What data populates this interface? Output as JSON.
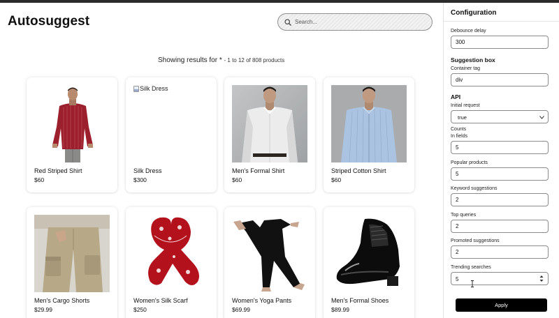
{
  "app": {
    "title": "Autosuggest"
  },
  "search": {
    "placeholder": "Search..."
  },
  "results": {
    "prefix": "Showing results for",
    "query": "*",
    "summary": "- 1 to 12 of 808 products"
  },
  "products": [
    {
      "name": "Red Striped Shirt",
      "price": "$60",
      "image": "red-shirt"
    },
    {
      "name": "Silk Dress",
      "price": "$300",
      "image": "broken",
      "alt": "Silk Dress"
    },
    {
      "name": "Men's Formal Shirt",
      "price": "$60",
      "image": "white-shirt"
    },
    {
      "name": "Striped Cotton Shirt",
      "price": "$60",
      "image": "blue-shirt"
    },
    {
      "name": "Men's Cargo Shorts",
      "price": "$29.99",
      "image": "cargo-shorts"
    },
    {
      "name": "Women's Silk Scarf",
      "price": "$250",
      "image": "silk-scarf"
    },
    {
      "name": "Women's Yoga Pants",
      "price": "$69.99",
      "image": "yoga-pants"
    },
    {
      "name": "Men's Formal Shoes",
      "price": "$89.99",
      "image": "formal-shoes"
    }
  ],
  "config": {
    "title": "Configuration",
    "debounce_label": "Debounce delay",
    "debounce_value": "300",
    "suggestion_box_title": "Suggestion box",
    "container_tag_label": "Container tag",
    "container_tag_value": "div",
    "api_title": "API",
    "initial_request_label": "Initial request",
    "initial_request_value": "true",
    "counts_label": "Counts",
    "in_fields_label": "In fields",
    "in_fields_value": "5",
    "popular_products_label": "Popular products",
    "popular_products_value": "5",
    "keyword_suggestions_label": "Keyword suggestions",
    "keyword_suggestions_value": "2",
    "top_queries_label": "Top queries",
    "top_queries_value": "2",
    "promoted_suggestions_label": "Promoted suggestions",
    "promoted_suggestions_value": "2",
    "trending_searches_label": "Trending searches",
    "trending_searches_value": "5",
    "apply_label": "Apply"
  },
  "colors": {
    "accent": "#000000",
    "search_bg": "#efefef",
    "card_shadow": "#e0e0e0"
  }
}
